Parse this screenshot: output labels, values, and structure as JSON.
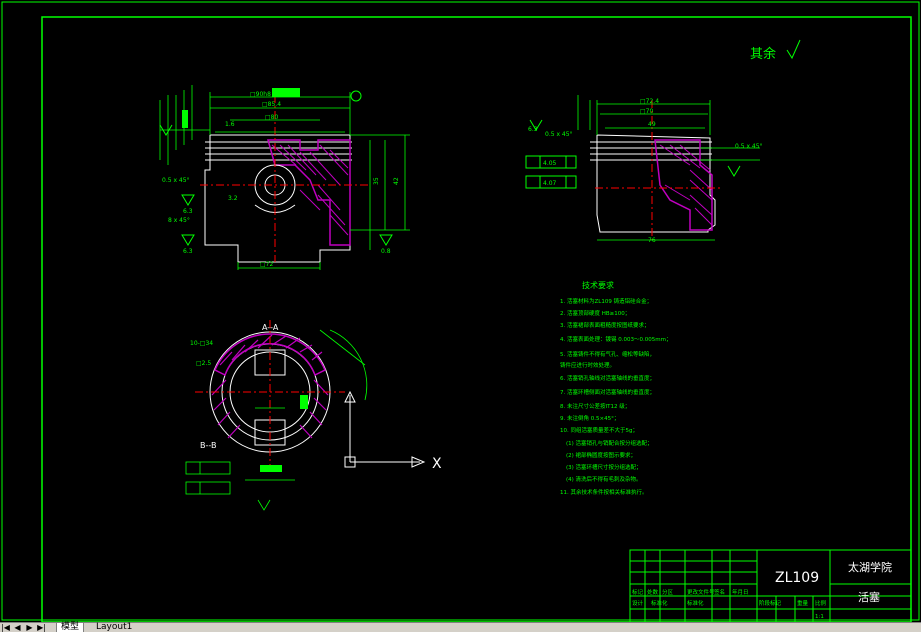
{
  "drawing": {
    "surface_roughness_note": "其余",
    "material": "ZL109",
    "school": "太湖学院",
    "part_name": "活塞",
    "section_label": "A--A",
    "section_b_label": "B--B",
    "tech_title": "技术要求",
    "tech_lines": [
      "1. 活塞材料为ZL109 铸造铝硅合金；",
      "2. 活塞顶部硬度 HB≥100；",
      "3. 活塞裙部表面粗糙度按图纸要求；",
      "4. 活塞表面处理：镀锡 0.003～0.005mm；",
      "5. 活塞铸件不得有气孔、缩松等缺陷，",
      "   铸件应进行时效处理。",
      "6. 活塞销孔轴线对活塞轴线的垂直度；",
      "7. 活塞环槽侧面对活塞轴线的垂直度；",
      "8. 未注尺寸公差按IT12 级；",
      "9. 未注倒角 0.5×45°；",
      "10. 同组活塞质量差不大于5g；",
      "  (1) 活塞销孔与销配合按分组选配；",
      "  (2) 裙部椭圆度按图示要求；",
      "  (3) 活塞环槽尺寸按分组选配；",
      "  (4) 清洗后不得有毛刺及杂物。",
      "11. 其余技术条件按相关标准执行。"
    ],
    "ucs_x_label": "X",
    "dims_front": [
      "□90h8",
      "□85.4",
      "□80",
      "□72",
      "35",
      "42",
      "1.6",
      "3.2",
      "0.5 x 45°",
      "8 x 45°",
      "□72"
    ],
    "dims_side": [
      "□72.4",
      "□70",
      "49",
      "76",
      "0.5 x 45°",
      "4.05",
      "4.07"
    ],
    "roughness_values": [
      "6.3",
      "6.3",
      "0.8",
      "6.3",
      "6.3"
    ]
  },
  "title_block": {
    "rows": [
      "标记",
      "处数",
      "分区",
      "更改文件号",
      "签名",
      "年月日"
    ],
    "labels": [
      "设计",
      "标准化",
      "阶段标记",
      "重量",
      "比例"
    ],
    "scale": "1:1"
  },
  "layout_tabs": {
    "items": [
      "模型",
      "Layout1"
    ],
    "active": 0
  },
  "colors": {
    "background": "#000000",
    "frame": "#00ff00",
    "drawing": "#ffffff",
    "hatch": "#c000c0",
    "text": "#00ff00",
    "center": "#ff0000",
    "ucs": "#ffffff",
    "fill_green": "#00ff00"
  }
}
